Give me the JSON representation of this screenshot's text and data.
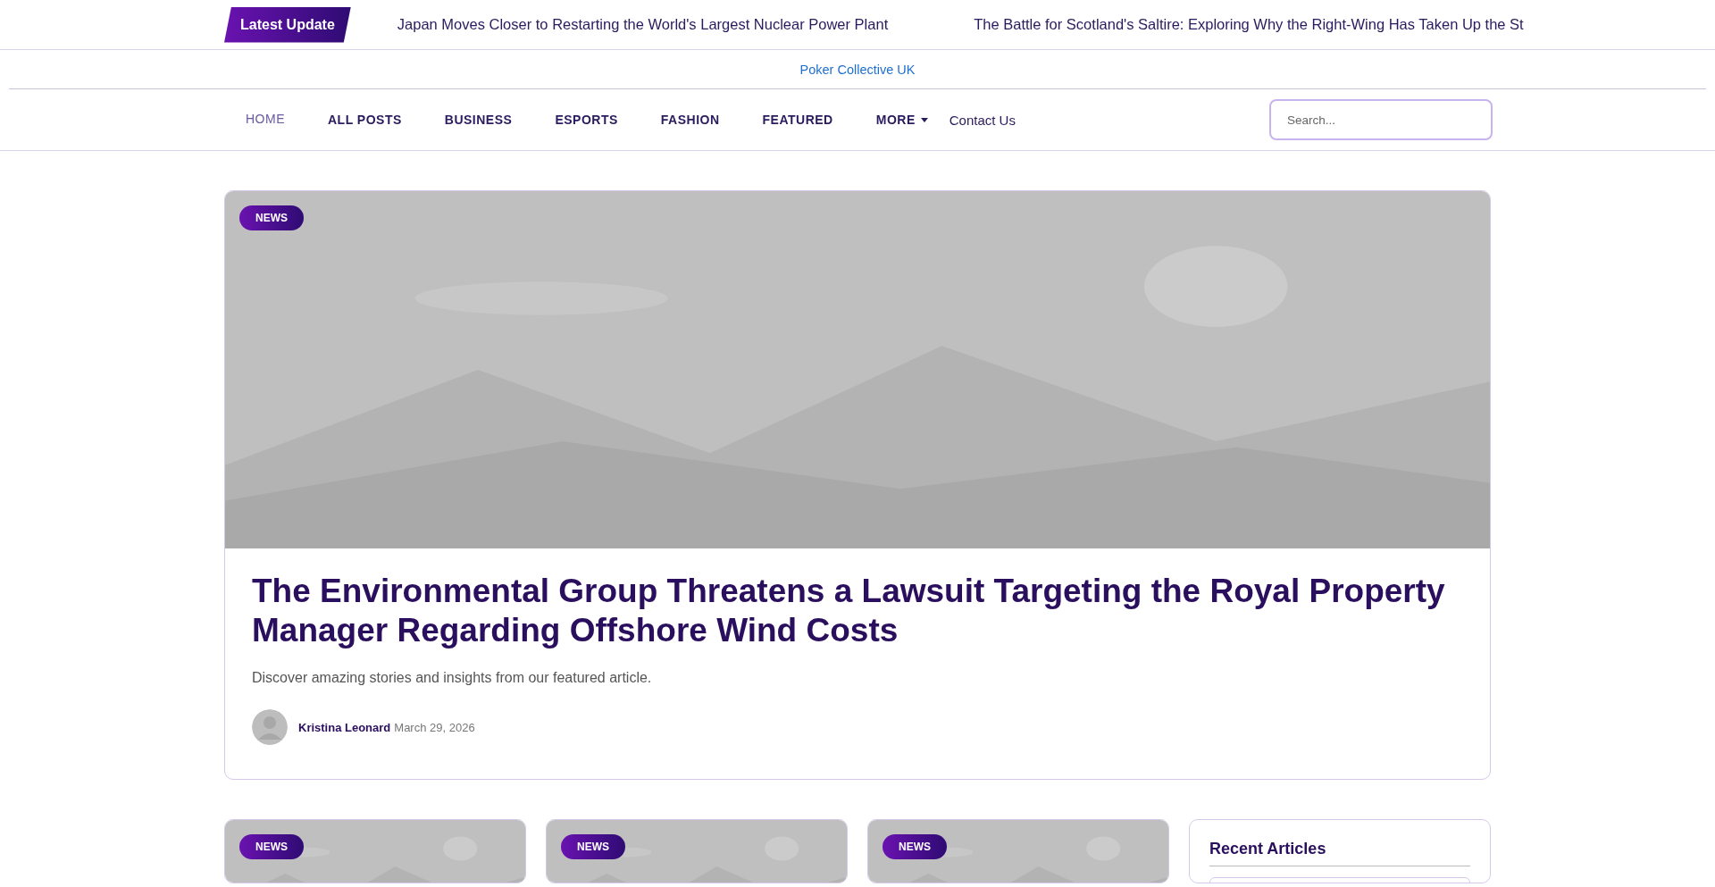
{
  "ticker": {
    "badge": "Latest Update",
    "headlines": [
      "Japan Moves Closer to Restarting the World's Largest Nuclear Power Plant",
      "The Battle for Scotland's Saltire: Exploring Why the Right-Wing Has Taken Up the St"
    ]
  },
  "site_link": "Poker Collective UK",
  "nav": {
    "items": [
      {
        "label": "HOME",
        "kind": "link",
        "selected": true
      },
      {
        "label": "ALL POSTS",
        "kind": "link",
        "selected": false
      },
      {
        "label": "BUSINESS",
        "kind": "link",
        "selected": false
      },
      {
        "label": "ESPORTS",
        "kind": "link",
        "selected": false
      },
      {
        "label": "FASHION",
        "kind": "link",
        "selected": false
      },
      {
        "label": "FEATURED",
        "kind": "link",
        "selected": false
      },
      {
        "label": "MORE",
        "kind": "dropdown",
        "selected": false
      },
      {
        "label": "Contact Us",
        "kind": "plain",
        "selected": false
      }
    ],
    "search_placeholder": "Search..."
  },
  "featured": {
    "tag": "NEWS",
    "title": "The Environmental Group Threatens a Lawsuit Targeting the Royal Property Manager Regarding Offshore Wind Costs",
    "excerpt": "Discover amazing stories and insights from our featured article.",
    "author": "Kristina Leonard",
    "date": "March 29, 2026"
  },
  "cards": [
    {
      "tag": "NEWS"
    },
    {
      "tag": "NEWS"
    },
    {
      "tag": "NEWS"
    }
  ],
  "sidebar": {
    "title": "Recent Articles"
  }
}
